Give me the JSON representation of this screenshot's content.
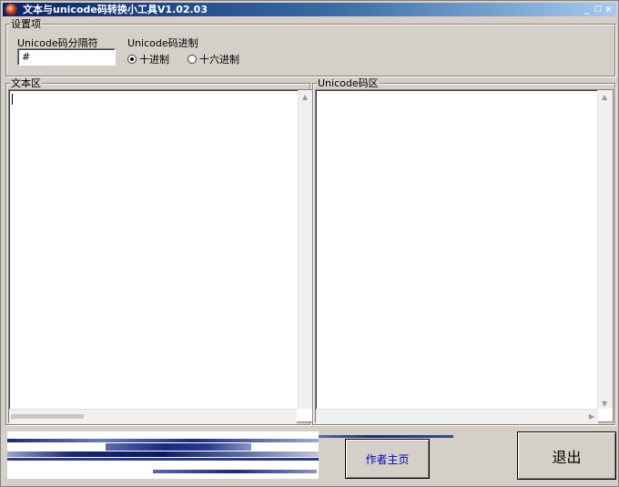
{
  "window": {
    "title": "文本与unicode码转换小工具V1.02.03"
  },
  "titlebar": {
    "minimize": "_",
    "maximize": "□",
    "close": "×"
  },
  "settings": {
    "legend": "设置项",
    "separator_label": "Unicode码分隔符",
    "separator_value": "#",
    "radix_label": "Unicode码进制",
    "options": [
      {
        "label": "十进制",
        "checked": true
      },
      {
        "label": "十六进制",
        "checked": false
      }
    ]
  },
  "text_area": {
    "legend": "文本区",
    "content": ""
  },
  "unicode_area": {
    "legend": "Unicode码区",
    "content": ""
  },
  "buttons": {
    "author_home": "作者主页",
    "exit": "退出"
  },
  "colors": {
    "title_start": "#0a246a",
    "title_end": "#a6caf0",
    "link_text": "#0000c0",
    "banner_dark": "#1a2a7a",
    "banner_mid": "#5a6aa8"
  }
}
